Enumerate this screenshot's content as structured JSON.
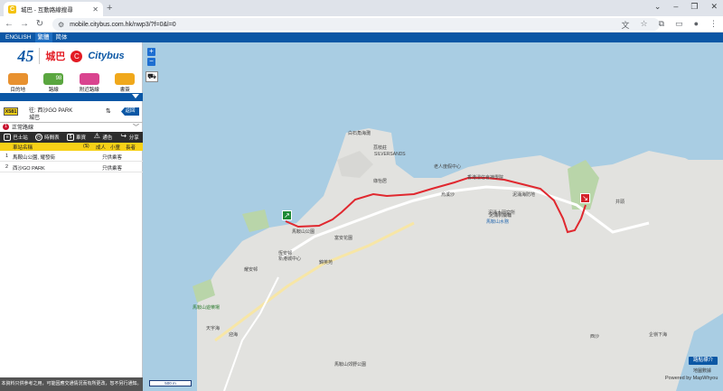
{
  "browser": {
    "tab_title": "城巴 - 互動路線搜尋",
    "tab_favicon": "C",
    "url": "mobile.citybus.com.hk/nwp3/?f=0&l=0"
  },
  "app_nav": [
    "ENGLISH",
    "繁體",
    "简体"
  ],
  "brand": {
    "cn_name": "城巴",
    "en_name": "Citybus"
  },
  "menu": [
    {
      "label": "目的地",
      "icon": "pin-icon",
      "color": "#e8912f"
    },
    {
      "label": "路線",
      "icon": "bus-route-icon",
      "color": "#5aa63f",
      "badge": "98"
    },
    {
      "label": "附近路線",
      "icon": "walker-icon",
      "color": "#d9448f"
    },
    {
      "label": "書簽",
      "icon": "bookmark-icon",
      "color": "#f0a81b"
    }
  ],
  "route": {
    "number": "X581",
    "dest_line1": "往: 西沙GO PARK",
    "dest_line2": "城巴",
    "back_label": "返回"
  },
  "direction": {
    "num": "1",
    "label": "正常路線"
  },
  "actions": [
    {
      "label": "巴士站",
      "icon": "bus-stop-icon"
    },
    {
      "label": "時間表",
      "icon": "clock-icon"
    },
    {
      "label": "車資",
      "icon": "fare-icon"
    },
    {
      "label": "通告",
      "icon": "warning-icon"
    },
    {
      "label": "分享",
      "icon": "share-icon"
    }
  ],
  "table_headers": {
    "stop": "車站名稱",
    "fare": "($)",
    "fare_sub": "成人",
    "special": "小童",
    "view": "長者"
  },
  "stops": [
    {
      "seq": "1",
      "name": "馬鞍山公園, 耀發街",
      "fare": "只供乘客"
    },
    {
      "seq": "2",
      "name": "西沙GO PARK",
      "fare": "只供乘客"
    }
  ],
  "disclaimer": "本資料只供參考之用，可能因應交通情況而有所更改，恕不另行通知。",
  "map": {
    "scale_label": "500 m",
    "legend_button": "路點標介",
    "copyright_1": "地圖數據",
    "copyright_2": "Powered by MapWhyou",
    "labels": [
      "白石角海灘",
      "荔枝莊",
      "SILVERSANDS",
      "老人度假中心",
      "香港浸信會神學院",
      "泥涌海防地",
      "泥涌帆纜輪",
      "馬鞍山水務",
      "馬鞍山公園",
      "恆安邨",
      "耀安邨",
      "新港城中心",
      "錦英苑",
      "富安花園",
      "馬鞍山遊樂場",
      "天宇海",
      "迎海",
      "綠怡居",
      "西沙",
      "馬鞍山郊野公園",
      "泥涌木研究所",
      "井頭",
      "烏溪沙",
      "企嶺下海"
    ]
  }
}
